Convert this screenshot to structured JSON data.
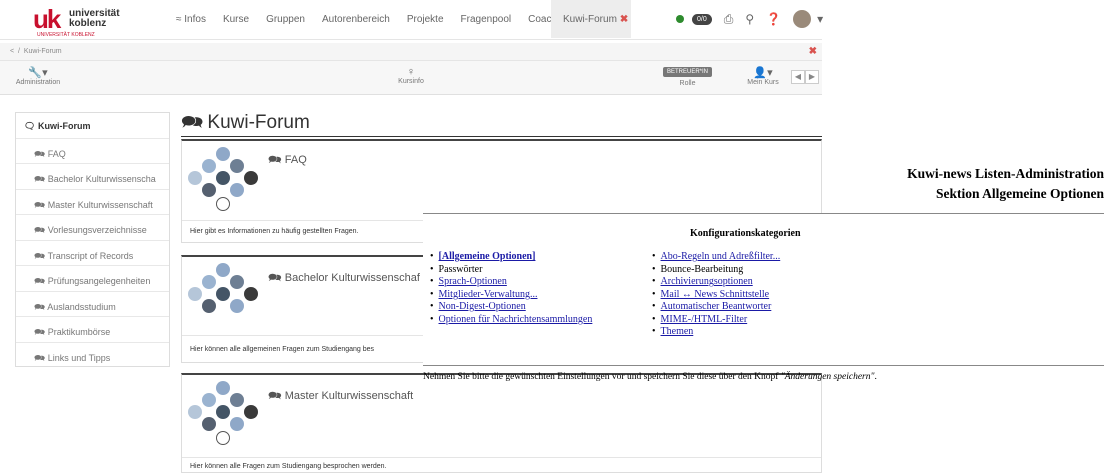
{
  "logo": {
    "mark": "uk",
    "line1": "universität",
    "line2": "koblenz",
    "tag": "UNIVERSITÄT KOBLENZ"
  },
  "nav": {
    "items": [
      "≈ Infos",
      "Kurse",
      "Gruppen",
      "Autorenbereich",
      "Projekte",
      "Fragenpool",
      "Coaching"
    ],
    "active_tab": "Kuwi-Forum",
    "status_count": "0/0"
  },
  "breadcrumb": {
    "back": "<",
    "path": "Kuwi-Forum"
  },
  "toolbar": {
    "administration": "Administration",
    "kursinfo": "Kursinfo",
    "role_button": "BETREUER*IN",
    "role_label": "Rolle",
    "mein_kurs": "Mein Kurs"
  },
  "sidebar": {
    "items": [
      "Kuwi-Forum",
      "FAQ",
      "Bachelor Kulturwissenscha",
      "Master Kulturwissenschaft",
      "Vorlesungsverzeichnisse",
      "Transcript of Records",
      "Prüfungsangelegenheiten",
      "Auslandsstudium",
      "Praktikumbörse",
      "Links und Tipps"
    ]
  },
  "main": {
    "title": "Kuwi-Forum",
    "cards": [
      {
        "title": "FAQ",
        "desc": "Hier gibt es Informationen zu häufig gestellten Fragen."
      },
      {
        "title": "Bachelor Kulturwissenschaf",
        "desc": "Hier können alle allgemeinen Fragen zum Studiengang bes"
      },
      {
        "title": "Master Kulturwissenschaft",
        "desc": "Hier können alle Fragen zum Studiengang besprochen werden."
      }
    ]
  },
  "overlay": {
    "heading1": "Kuwi-news Listen-Administration",
    "heading2": "Sektion Allgemeine Optionen",
    "kat_title": "Konfigurationskategorien",
    "left": [
      {
        "label": "[Allgemeine Optionen]",
        "kind": "selected"
      },
      {
        "label": "Passwörter",
        "kind": "plain"
      },
      {
        "label": "Sprach-Optionen",
        "kind": "link"
      },
      {
        "label": "Mitglieder-Verwaltung...",
        "kind": "link"
      },
      {
        "label": "Non-Digest-Optionen",
        "kind": "link"
      },
      {
        "label": "Optionen für Nachrichtensammlungen",
        "kind": "link"
      }
    ],
    "right": [
      {
        "label": "Abo-Regeln und Adreßfilter...",
        "kind": "link"
      },
      {
        "label": "Bounce-Bearbeitung",
        "kind": "plain"
      },
      {
        "label": "Archivierungsoptionen",
        "kind": "link"
      },
      {
        "label": "Mail ↔ News Schnittstelle",
        "kind": "link"
      },
      {
        "label": "Automatischer Beantworter",
        "kind": "link"
      },
      {
        "label": "MIME-/HTML-Filter",
        "kind": "link"
      },
      {
        "label": "Themen",
        "kind": "link"
      }
    ],
    "note_prefix": "Nehmen Sie bitte die gewünschten Einstellungen vor und speichern Sie diese über den Knopf ",
    "note_button": "\"Änderungen speichern\"",
    "note_suffix": "."
  }
}
